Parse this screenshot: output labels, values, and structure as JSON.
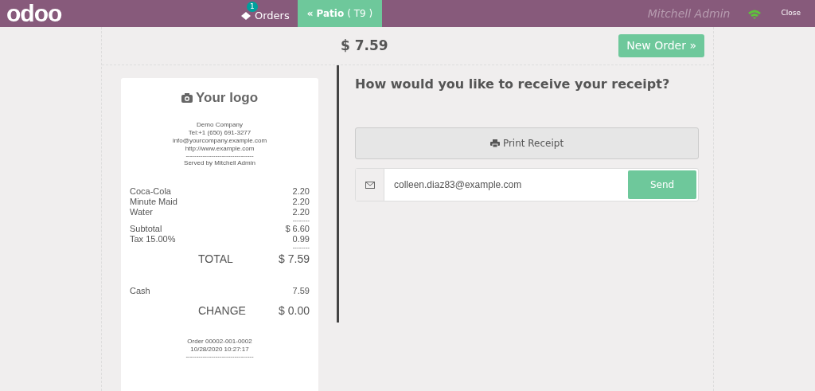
{
  "header": {
    "logo": "odoo",
    "orders": {
      "label": "Orders",
      "count": "1"
    },
    "tabs": [
      {
        "icon": "«",
        "label": "Patio",
        "sub": "( T9 )",
        "selected": true
      }
    ],
    "user": "Mitchell Admin",
    "close": "Close"
  },
  "top": {
    "amount": "$ 7.59",
    "new_order": "New Order »"
  },
  "receipt": {
    "logo": "Your logo",
    "company": [
      "Demo Company",
      "Tel:+1 (650) 691-3277",
      "info@yourcompany.example.com",
      "http://www.example.com"
    ],
    "rule": "--------------------------------",
    "served": "Served by Mitchell Admin",
    "lines": [
      {
        "name": "Coca-Cola",
        "price": "2.20"
      },
      {
        "name": "Minute Maid",
        "price": "2.20"
      },
      {
        "name": "Water",
        "price": "2.20"
      }
    ],
    "rule_short": "--------",
    "subtotal": {
      "label": "Subtotal",
      "value": "$ 6.60"
    },
    "tax": {
      "label": "Tax 15.00%",
      "value": "0.99"
    },
    "total": {
      "label": "TOTAL",
      "value": "$ 7.59"
    },
    "payment": {
      "label": "Cash",
      "value": "7.59"
    },
    "change": {
      "label": "CHANGE",
      "value": "$ 0.00"
    },
    "order": "Order 00002-001-0002",
    "date": "10/28/2020 10:27:17",
    "rule_bottom": "--------------------------------"
  },
  "panel": {
    "question": "How would you like to receive your receipt?",
    "print": "Print Receipt",
    "email": "colleen.diaz83@example.com",
    "send": "Send"
  }
}
